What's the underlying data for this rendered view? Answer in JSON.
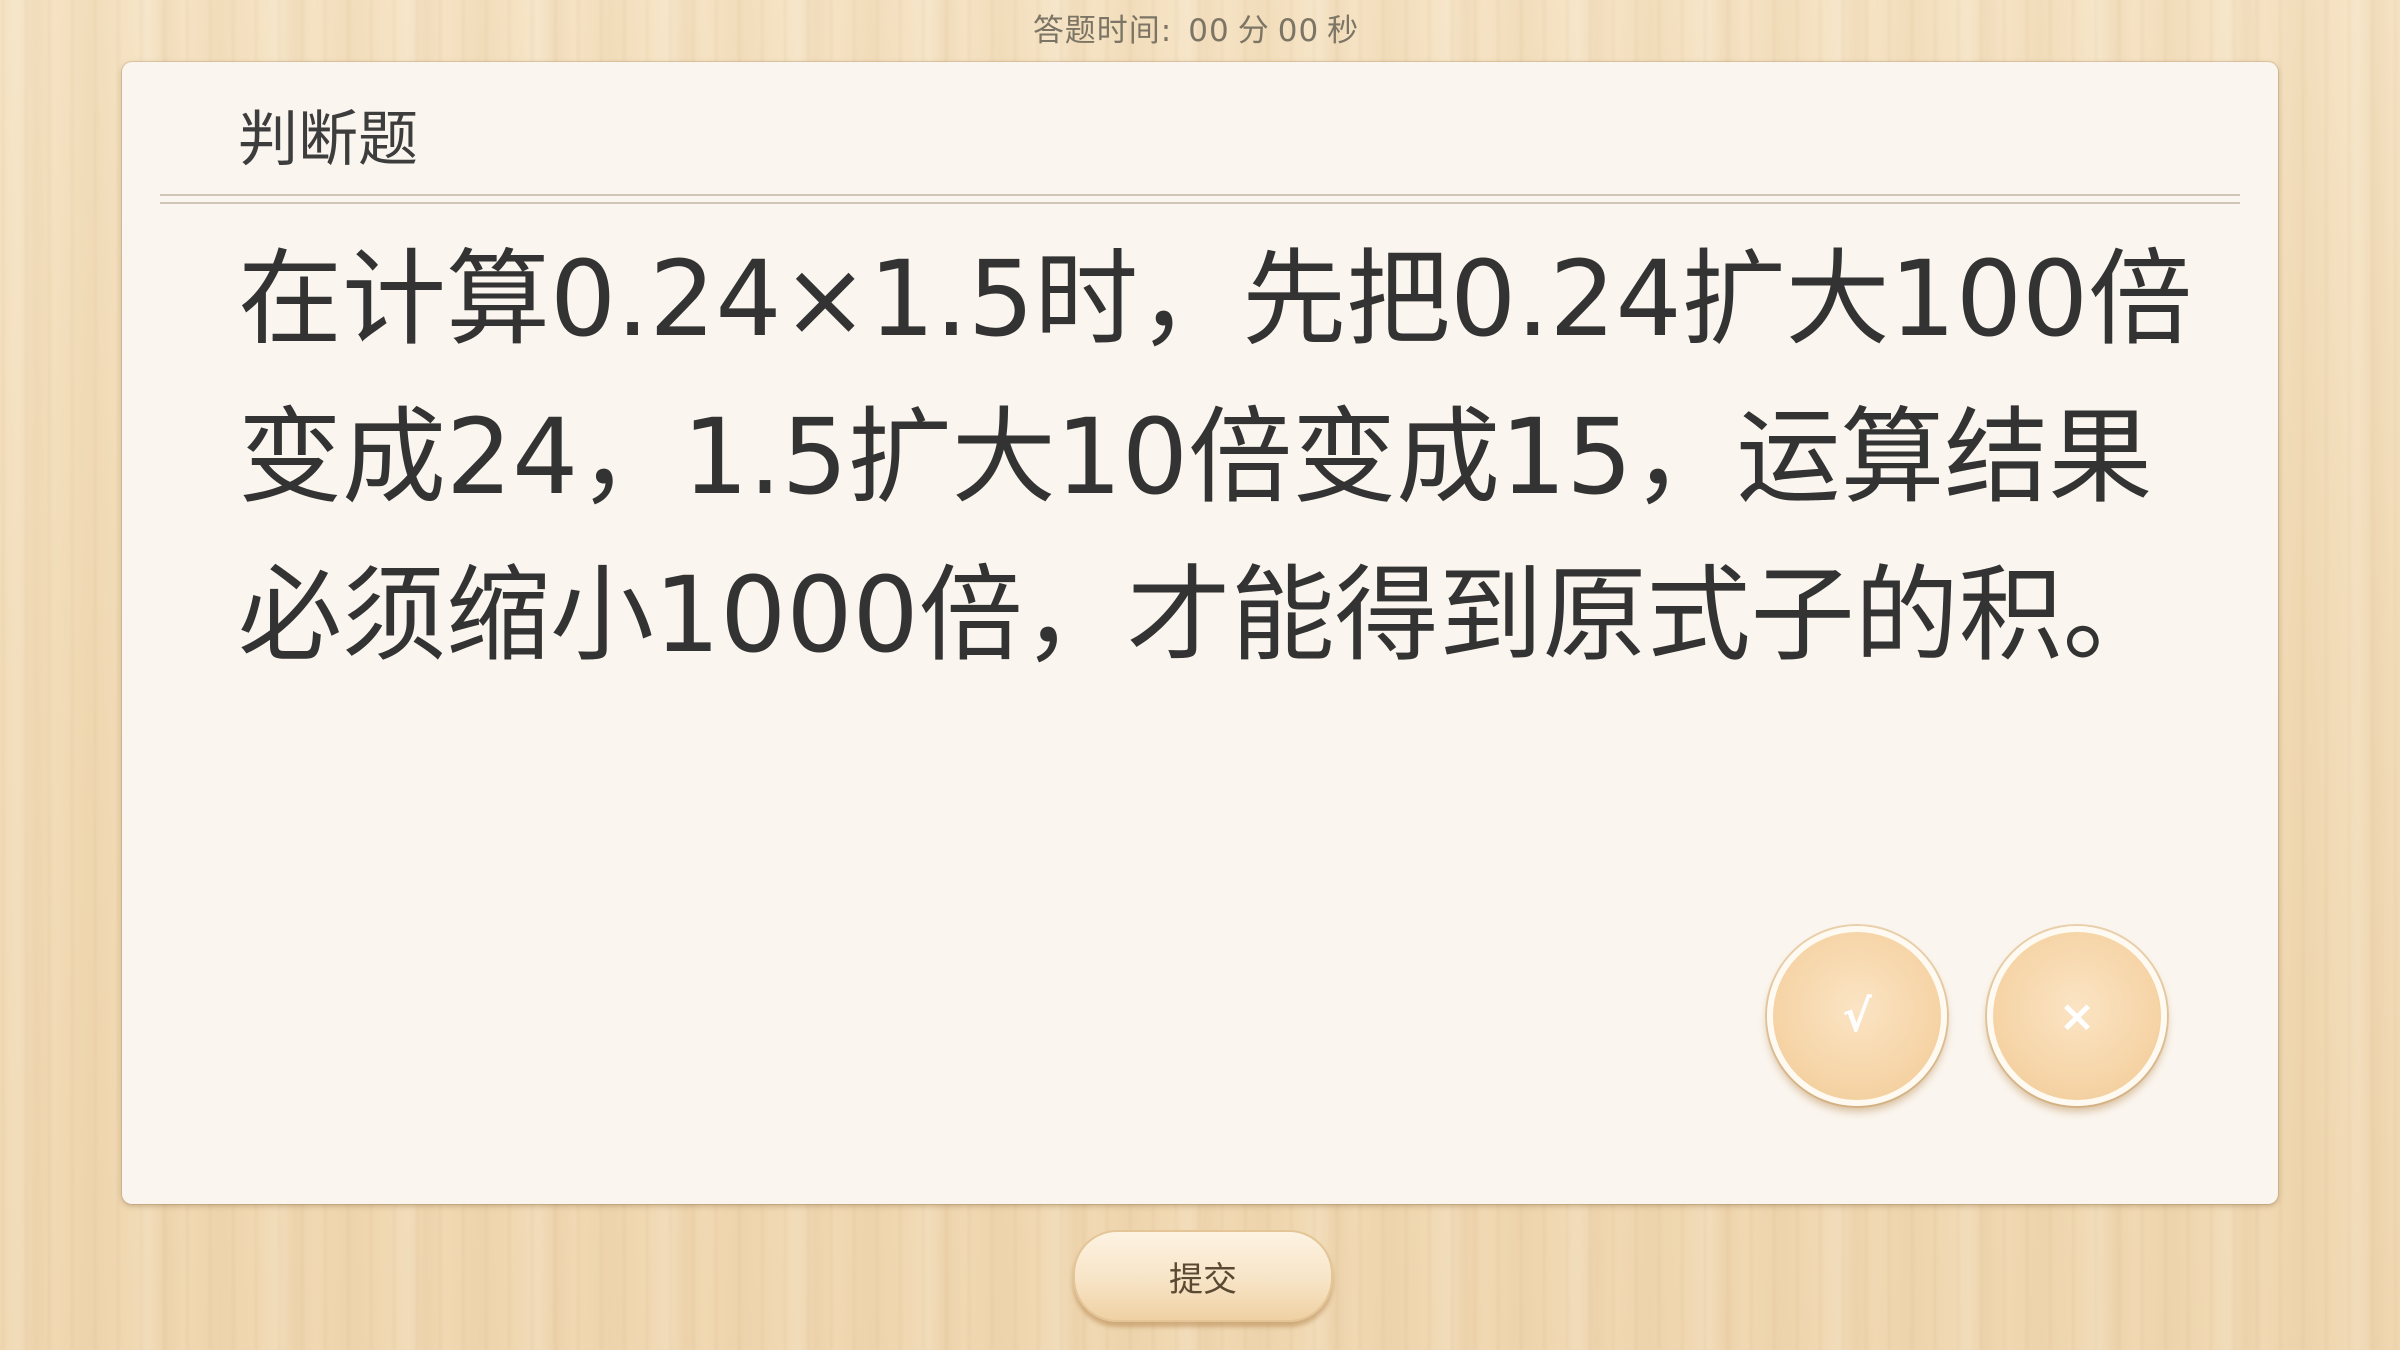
{
  "timer": {
    "label": "答题时间:",
    "minutes": "00",
    "minutes_unit": "分",
    "seconds": "00",
    "seconds_unit": "秒"
  },
  "question": {
    "type": "判断题",
    "text": "在计算0.24×1.5时，先把0.24扩大100倍变成24，1.5扩大10倍变成15，运算结果必须缩小1000倍，才能得到原式子的积。"
  },
  "answers": {
    "true_label": "√",
    "false_label": "×"
  },
  "submit": {
    "label": "提交"
  }
}
